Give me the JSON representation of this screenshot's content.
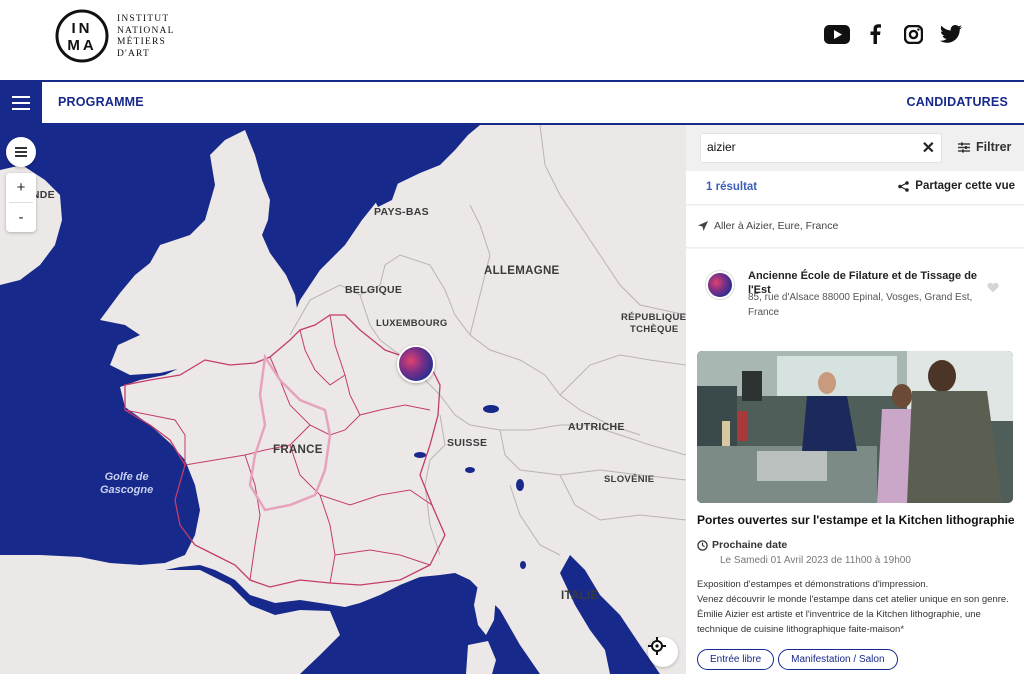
{
  "brand": {
    "logo_letters": "INMA",
    "line1": "INSTITUT",
    "line2": "NATIONAL",
    "line3": "MÉTIERS",
    "line4": "D'ART"
  },
  "social": [
    "youtube-icon",
    "facebook-icon",
    "instagram-icon",
    "twitter-icon"
  ],
  "nav": {
    "programme": "PROGRAMME",
    "candidatures": "CANDIDATURES"
  },
  "map": {
    "labels": {
      "irlande": "ANDE",
      "pays_bas": "PAYS-BAS",
      "allemagne": "ALLEMAGNE",
      "belgique": "BELGIQUE",
      "luxembourg": "LUXEMBOURG",
      "republique1": "RÉPUBLIQUE",
      "republique2": "TCHÈQUE",
      "france": "FRANCE",
      "suisse": "SUISSE",
      "autriche": "AUTRICHE",
      "slovenie": "SLOVÉNIE",
      "italie": "ITALIE",
      "golfe1": "Golfe de",
      "golfe2": "Gascogne"
    },
    "zoom_in": "+",
    "zoom_out": "-"
  },
  "panel": {
    "search_value": "aizier",
    "filter_label": "Filtrer",
    "results_count": "1 résultat",
    "share_label": "Partager cette vue",
    "goto_label": "Aller à Aizier, Eure, France",
    "place_name": "Ancienne École de Filature et de Tissage de l'Est",
    "place_address": "85, rue d'Alsace 88000 Epinal, Vosges, Grand Est, France",
    "event_title": "Portes ouvertes sur l'estampe et la Kitchen lithographie",
    "next_date_label": "Prochaine date",
    "next_date_value": "Le Samedi 01 Avril 2023 de 11h00 à 19h00",
    "description_1": "Exposition d'estampes et démonstrations d'impression.",
    "description_2": "Venez découvrir le monde l'estampe dans cet atelier unique en son genre. Émilie Aizier est artiste et l'inventrice de la Kitchen lithographie, une technique de cuisine lithographique faite-maison*",
    "tags": [
      "Entrée libre",
      "Manifestation / Salon"
    ]
  },
  "colors": {
    "brand_blue": "#17298b",
    "land": "#ece8e7",
    "border_pink": "#c23d6a"
  }
}
